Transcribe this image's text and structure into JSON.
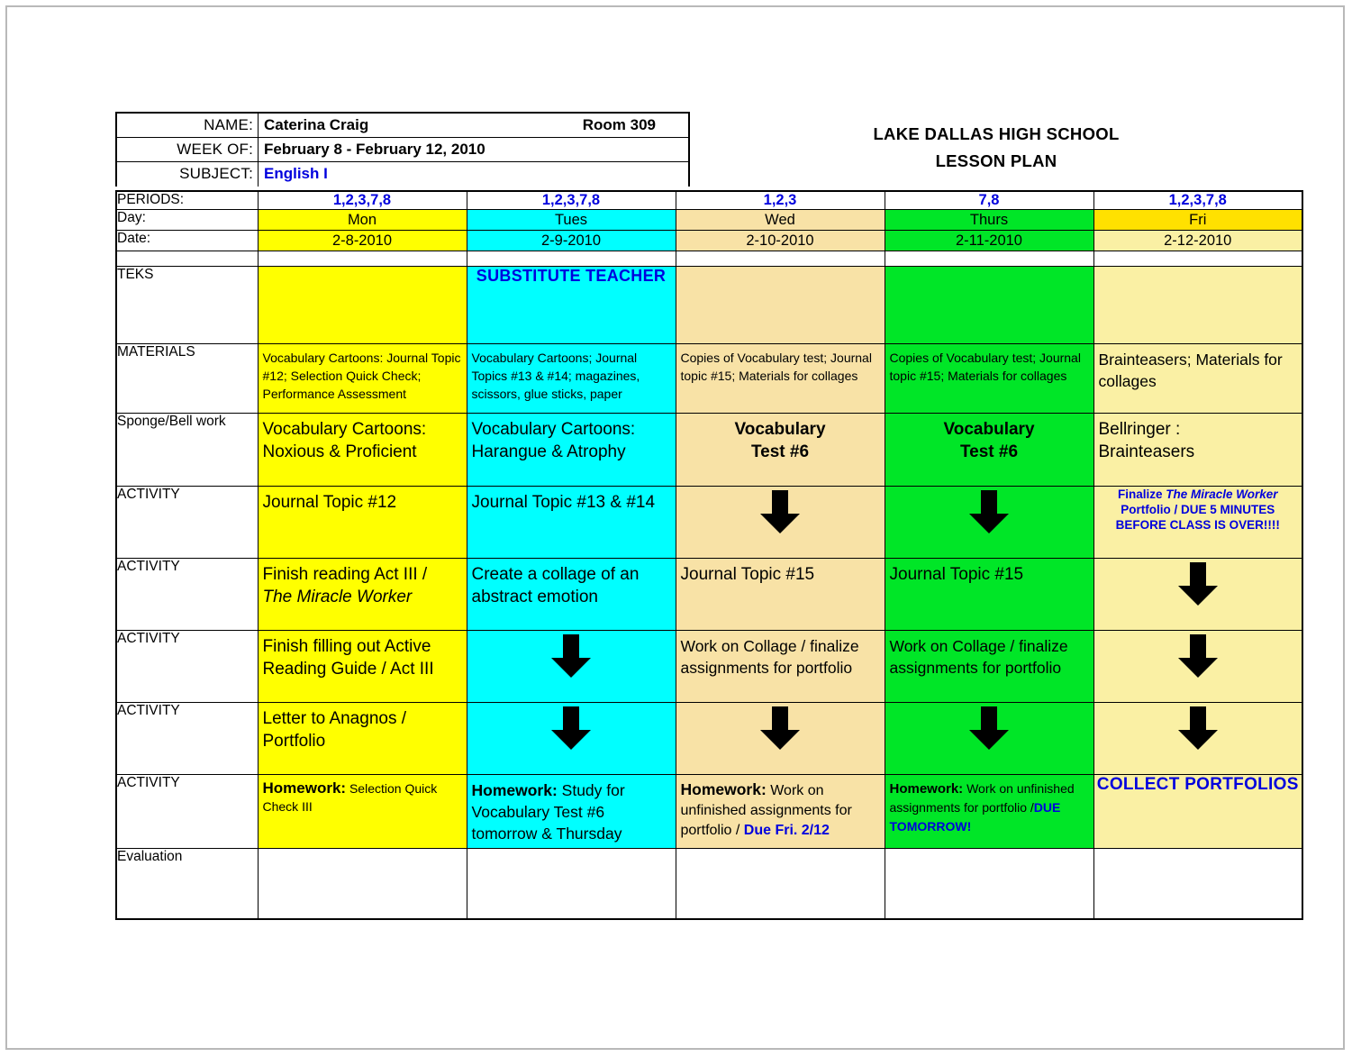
{
  "meta": {
    "colors": {
      "mon": "#ffff00",
      "tues": "#00ffff",
      "wed": "#f8e2a6",
      "thurs": "#00e627",
      "fri": "#faf0a4",
      "fri_day_header": "#ffe100",
      "accent_blue": "#0000dd"
    }
  },
  "header": {
    "name_label": "NAME:",
    "name_value": "Caterina Craig",
    "room": "Room 309",
    "week_label": "WEEK OF:",
    "week_value": "February 8 - February 12, 2010",
    "subject_label": "SUBJECT:",
    "subject_value": "English I",
    "school_title_line1": "LAKE DALLAS HIGH SCHOOL",
    "school_title_line2": "LESSON PLAN"
  },
  "row_labels": {
    "periods": "PERIODS:",
    "day": "Day:",
    "date": "Date:",
    "teks": "TEKS",
    "materials": "MATERIALS",
    "sponge": "Sponge/Bell work",
    "activity": "ACTIVITY",
    "evaluation": "Evaluation"
  },
  "columns": [
    {
      "key": "mon",
      "periods": "1,2,3,7,8",
      "day": "Mon",
      "date": "2-8-2010",
      "teks": "",
      "materials": "Vocabulary Cartoons: Journal Topic #12; Selection Quick Check; Performance Assessment",
      "sponge": "Vocabulary Cartoons: Noxious & Proficient",
      "activity1": "Journal Topic #12",
      "activity2_line1": "Finish reading Act III /",
      "activity2_line2": "The Miracle Worker",
      "activity3": "Finish filling out Active Reading Guide / Act III",
      "activity4": "Letter to Anagnos / Portfolio",
      "homework_label": "Homework:",
      "homework_text": " Selection Quick Check III",
      "homework_due": "",
      "evaluation": ""
    },
    {
      "key": "tues",
      "periods": "1,2,3,7,8",
      "day": "Tues",
      "date": "2-9-2010",
      "teks": "SUBSTITUTE TEACHER",
      "materials": "Vocabulary Cartoons; Journal Topics    #13 & #14; magazines, scissors, glue sticks, paper",
      "sponge": "Vocabulary Cartoons: Harangue & Atrophy",
      "activity1": "Journal Topic #13 & #14",
      "activity2_line1": "Create a collage of an",
      "activity2_line2": "abstract emotion",
      "activity3": "down-arrow",
      "activity4": "down-arrow",
      "homework_label": "Homework:",
      "homework_text": " Study for Vocabulary Test #6 tomorrow & Thursday",
      "homework_due": "",
      "evaluation": ""
    },
    {
      "key": "wed",
      "periods": "1,2,3",
      "day": "Wed",
      "date": "2-10-2010",
      "teks": "",
      "materials": "Copies of Vocabulary test; Journal topic #15; Materials for collages",
      "sponge_line1": "Vocabulary",
      "sponge_line2": "Test #6",
      "activity1": "down-arrow",
      "activity2": "Journal Topic #15",
      "activity3": "Work on Collage / finalize assignments for portfolio",
      "activity4": "down-arrow",
      "homework_label": "Homework:",
      "homework_text": " Work on unfinished assignments for portfolio / ",
      "homework_due": "Due Fri. 2/12",
      "evaluation": ""
    },
    {
      "key": "thurs",
      "periods": "7,8",
      "day": "Thurs",
      "date": "2-11-2010",
      "teks": "",
      "materials": "Copies of Vocabulary test; Journal topic #15; Materials for collages",
      "sponge_line1": "Vocabulary",
      "sponge_line2": "Test #6",
      "activity1": "down-arrow",
      "activity2": "Journal Topic #15",
      "activity3": "Work on Collage / finalize assignments for portfolio",
      "activity4": "down-arrow",
      "homework_label": "Homework:",
      "homework_text": " Work on unfinished assignments for portfolio /",
      "homework_due": "DUE TOMORROW!",
      "evaluation": ""
    },
    {
      "key": "fri",
      "periods": "1,2,3,7,8",
      "day": "Fri",
      "date": "2-12-2010",
      "teks": "",
      "materials": "Brainteasers; Materials    for collages",
      "sponge_line1": "Bellringer :",
      "sponge_line2": "Brainteasers",
      "activity1_a": "Finalize ",
      "activity1_b": "The Miracle Worker",
      "activity1_c": " Portfolio / DUE 5 MINUTES BEFORE CLASS IS OVER!!!!",
      "activity2": "down-arrow",
      "activity3": "down-arrow",
      "activity4": "down-arrow",
      "homework_collect": "COLLECT PORTFOLIOS",
      "evaluation": ""
    }
  ]
}
